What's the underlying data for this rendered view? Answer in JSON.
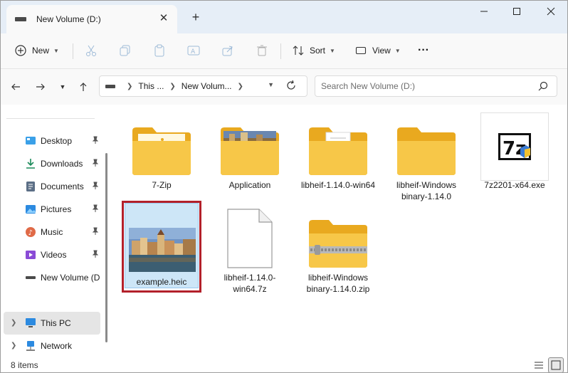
{
  "window": {
    "tab_title": "New Volume (D:)",
    "new_tab": "+"
  },
  "toolbar": {
    "new_label": "New",
    "sort_label": "Sort",
    "view_label": "View",
    "more": "···"
  },
  "address": {
    "crumbs": [
      "This ...",
      "New Volum..."
    ],
    "search_placeholder": "Search New Volume (D:)"
  },
  "sidebar": {
    "quick_access": [
      {
        "label": "Desktop",
        "icon": "desktop-icon",
        "pinned": true
      },
      {
        "label": "Downloads",
        "icon": "download-icon",
        "pinned": true
      },
      {
        "label": "Documents",
        "icon": "documents-icon",
        "pinned": true
      },
      {
        "label": "Pictures",
        "icon": "pictures-icon",
        "pinned": true
      },
      {
        "label": "Music",
        "icon": "music-icon",
        "pinned": true
      },
      {
        "label": "Videos",
        "icon": "videos-icon",
        "pinned": true
      },
      {
        "label": "New Volume (D:)",
        "icon": "drive-icon",
        "pinned": false
      }
    ],
    "this_pc": "This PC",
    "network": "Network"
  },
  "files": [
    {
      "name": "7-Zip",
      "type": "folder"
    },
    {
      "name": "Application",
      "type": "folder-photo"
    },
    {
      "name": "libheif-1.14.0-win64",
      "type": "folder-doc"
    },
    {
      "name": "libheif-Windows binary-1.14.0",
      "type": "folder"
    },
    {
      "name": "7z2201-x64.exe",
      "type": "exe"
    },
    {
      "name": "example.heic",
      "type": "image",
      "selected": true
    },
    {
      "name": "libheif-1.14.0-win64.7z",
      "type": "file"
    },
    {
      "name": "libheif-Windows binary-1.14.0.zip",
      "type": "zip"
    }
  ],
  "status": {
    "item_count": "8 items"
  },
  "colors": {
    "selection_outline": "#b3202a",
    "folder": "#f7c748",
    "accent": "#0067c0"
  }
}
